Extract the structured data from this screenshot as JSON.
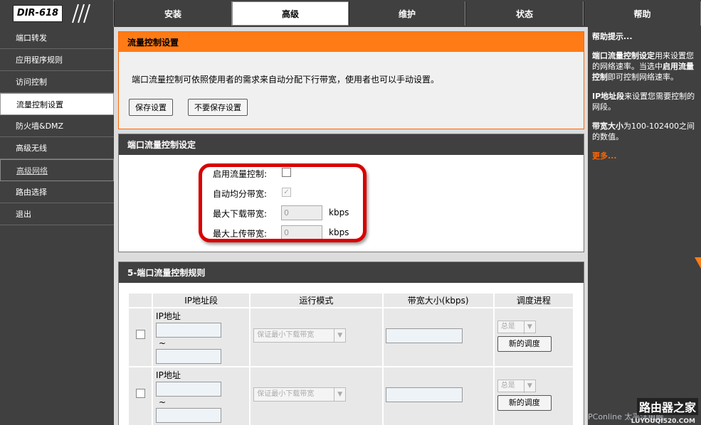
{
  "logo": {
    "text": "DIR-618"
  },
  "topnav": {
    "tabs": [
      {
        "label": "安装",
        "active": false
      },
      {
        "label": "高级",
        "active": true
      },
      {
        "label": "维护",
        "active": false
      },
      {
        "label": "状态",
        "active": false
      },
      {
        "label": "帮助",
        "active": false
      }
    ]
  },
  "sidebar": {
    "items": [
      {
        "label": "端口转发"
      },
      {
        "label": "应用程序规则"
      },
      {
        "label": "访问控制"
      },
      {
        "label": "流量控制设置"
      },
      {
        "label": "防火墙&DMZ"
      },
      {
        "label": "高级无线"
      },
      {
        "label": "高级网络"
      },
      {
        "label": "路由选择"
      },
      {
        "label": "退出"
      }
    ]
  },
  "traffic_settings": {
    "title": "流量控制设置",
    "description": "端口流量控制可依照使用者的需求来自动分配下行带宽，使用者也可以手动设置。",
    "save_label": "保存设置",
    "dont_save_label": "不要保存设置"
  },
  "port_traffic": {
    "title": "端口流量控制设定",
    "enable_label": "启用流量控制:",
    "auto_label": "自动均分带宽:",
    "max_down_label": "最大下载带宽:",
    "max_down_value": "0",
    "max_down_unit": "kbps",
    "max_up_label": "最大上传带宽:",
    "max_up_value": "0",
    "max_up_unit": "kbps"
  },
  "rules": {
    "title": "5-端口流量控制规则",
    "headers": [
      "IP地址段",
      "运行模式",
      "带宽大小(kbps)",
      "调度进程"
    ],
    "rows": [
      {
        "ip_label": "IP地址",
        "tilde": "~",
        "mode": "保证最小下载带宽",
        "schedule": "总是",
        "new_schedule": "新的调度"
      },
      {
        "ip_label": "IP地址",
        "tilde": "~",
        "mode": "保证最小下载带宽",
        "schedule": "总是",
        "new_schedule": "新的调度"
      }
    ]
  },
  "help": {
    "title": "帮助提示...",
    "p1_bold": "端口流量控制设定",
    "p1_rest": "用来设置您的网络速率。当选中",
    "p1_bold2": "启用流量控制",
    "p1_rest2": "即可控制网络速率。",
    "p2_bold": "IP地址段",
    "p2_rest": "来设置您需要控制的网段。",
    "p3_bold": "带宽大小",
    "p3_rest": "为100-102400之间的数值。",
    "more": "更多..."
  },
  "watermark": {
    "site": "路由器之家",
    "url": "LUYOUQI520.COM",
    "pconline": "PConline 太平洋电脑"
  }
}
